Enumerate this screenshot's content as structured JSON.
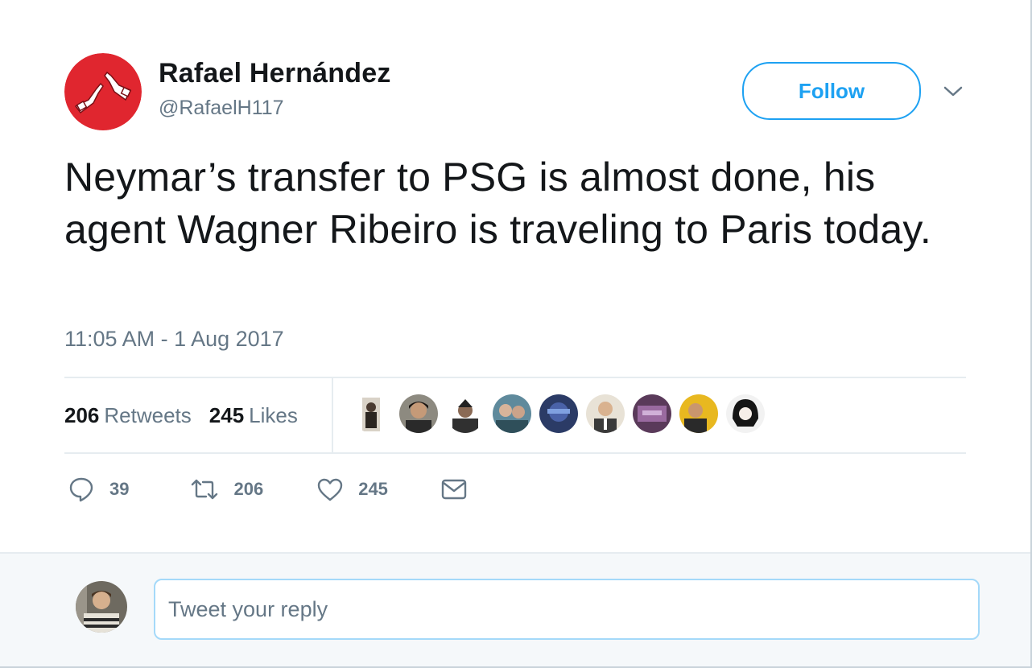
{
  "author": {
    "display_name": "Rafael Hernández",
    "handle": "@RafaelH117",
    "avatar_icon": "red-circle-handshake-icon",
    "avatar_color": "#e0262f"
  },
  "follow_button": {
    "label": "Follow"
  },
  "menu_caret_icon": "chevron-down-icon",
  "tweet": {
    "text": "Neymar’s transfer to PSG is almost done, his agent Wagner Ribeiro is traveling to Paris today.",
    "timestamp": "11:05 AM - 1 Aug 2017"
  },
  "stats": {
    "retweets": {
      "count": "206",
      "label": "Retweets"
    },
    "likes": {
      "count": "245",
      "label": "Likes"
    }
  },
  "likers_count_shown": 9,
  "actions": {
    "reply": {
      "icon": "reply-bubble-icon",
      "count": "39"
    },
    "retweet": {
      "icon": "retweet-icon",
      "count": "206"
    },
    "like": {
      "icon": "heart-icon",
      "count": "245"
    },
    "dm": {
      "icon": "envelope-icon"
    }
  },
  "reply_box": {
    "placeholder": "Tweet your reply"
  },
  "colors": {
    "accent": "#1da1f2",
    "text_primary": "#14171a",
    "text_secondary": "#657786",
    "divider": "#e6ecf0",
    "reply_bg": "#f5f8fa"
  }
}
